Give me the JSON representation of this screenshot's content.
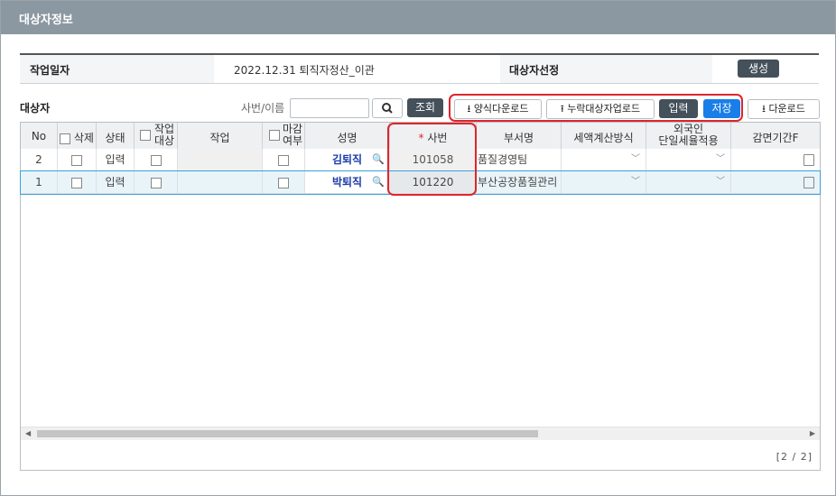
{
  "window": {
    "title": "대상자정보"
  },
  "info": {
    "work_date_label": "작업일자",
    "work_date_value": "2022.12.31 퇴직자정산_이관",
    "select_label": "대상자선정",
    "generate_button": "생성"
  },
  "toolbar": {
    "section_title": "대상자",
    "search_label": "사번/이름",
    "search_value": "",
    "query_button": "조회",
    "template_download": "양식다운로드",
    "missing_upload": "누락대상자업로드",
    "input_button": "입력",
    "save_button": "저장",
    "download_button": "다운로드"
  },
  "grid": {
    "columns": {
      "no": "No",
      "delete": "삭제",
      "status": "상태",
      "work_target_1": "작업",
      "work_target_2": "대상",
      "work": "작업",
      "closed_1": "마감",
      "closed_2": "여부",
      "name": "성명",
      "emp_no": "사번",
      "dept": "부서명",
      "tax_method": "세액계산방식",
      "foreigner_1": "외국인",
      "foreigner_2": "단일세율적용",
      "exempt": "감면기간F"
    },
    "rows": [
      {
        "no": "2",
        "status": "입력",
        "name": "김퇴직",
        "emp_no": "101058",
        "dept": "품질경영팀"
      },
      {
        "no": "1",
        "status": "입력",
        "name": "박퇴직",
        "emp_no": "101220",
        "dept": "부산공장품질관리"
      }
    ],
    "pager": "[2 / 2]"
  },
  "colors": {
    "titlebar": "#8b98a2",
    "dark_button": "#44505a",
    "save_button": "#1a7ee8",
    "highlight": "#e0242b",
    "required_star": "#e0242b"
  }
}
